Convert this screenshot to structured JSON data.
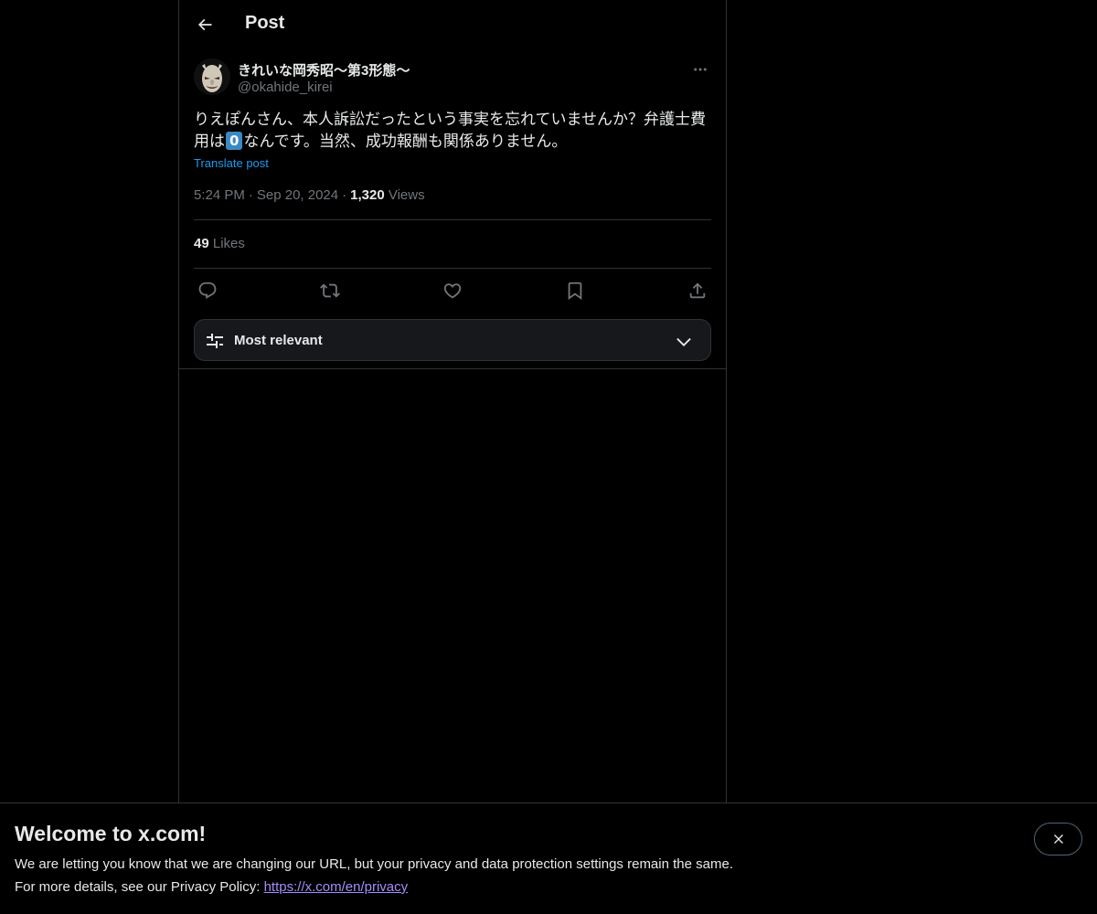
{
  "header": {
    "title": "Post"
  },
  "post": {
    "display_name": "きれいな岡秀昭〜第3形態〜",
    "handle": "@okahide_kirei",
    "text_before": "りえぽんさん、本人訴訟だったという事実を忘れていませんか？弁護士費用は",
    "keycap": "0",
    "text_after": "なんです。当然、成功報酬も関係ありません。",
    "translate_label": "Translate post",
    "time": "5:24 PM",
    "date": "Sep 20, 2024",
    "views_count": "1,320",
    "views_label": "Views",
    "likes_count": "49",
    "likes_label": "Likes"
  },
  "actions": [
    "reply-icon",
    "repost-icon",
    "like-icon",
    "bookmark-icon",
    "share-icon"
  ],
  "sort": {
    "label": "Most relevant"
  },
  "banner": {
    "title": "Welcome to x.com!",
    "line1": "We are letting you know that we are changing our URL, but your privacy and data protection settings remain the same.",
    "line2_prefix": "For more details, see our Privacy Policy: ",
    "link": "https://x.com/en/privacy"
  },
  "colors": {
    "background": "#000000",
    "text": "#e7e9ea",
    "muted": "#71767b",
    "accent": "#1d9bf0",
    "border": "#2f3336"
  }
}
